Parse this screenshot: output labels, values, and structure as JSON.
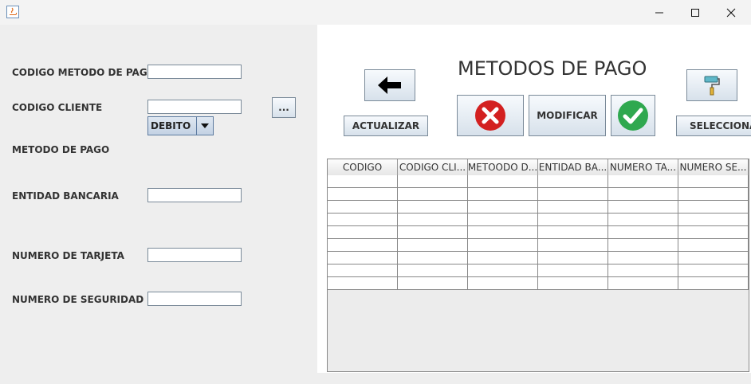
{
  "window": {
    "minimize_glyph": "—",
    "maximize_glyph": "☐",
    "close_glyph": "✕"
  },
  "form": {
    "codigo_metodo_label": "CODIGO METODO DE PAGO",
    "codigo_metodo_value": "",
    "codigo_cliente_label": "CODIGO CLIENTE",
    "codigo_cliente_value": "",
    "browse_button_label": "...",
    "metodo_label": "METODO DE PAGO",
    "metodo_selected": "DEBITO",
    "entidad_label": "ENTIDAD BANCARIA",
    "entidad_value": "",
    "tarjeta_label": "NUMERO DE TARJETA",
    "tarjeta_value": "",
    "seguridad_label": "NUMERO DE SEGURIDAD",
    "seguridad_value": ""
  },
  "header": {
    "title": "METODOS DE PAGO"
  },
  "toolbar": {
    "back_icon": "left-arrow-icon",
    "actualizar_label": "ACTUALIZAR",
    "delete_icon": "x-circle-icon",
    "modificar_label": "MODIFICAR",
    "confirm_icon": "check-circle-icon",
    "paint_icon": "paint-roller-icon",
    "seleccionar_label": "SELECCIONAR"
  },
  "colors": {
    "delete_red": "#d32020",
    "confirm_green": "#2fa84f"
  },
  "table": {
    "columns": [
      "CODIGO",
      "CODIGO CLI...",
      "METOODO D...",
      "ENTIDAD BA...",
      "NUMERO TA...",
      "NUMERO SE..."
    ],
    "rows": [
      [
        "",
        "",
        "",
        "",
        "",
        ""
      ],
      [
        "",
        "",
        "",
        "",
        "",
        ""
      ],
      [
        "",
        "",
        "",
        "",
        "",
        ""
      ],
      [
        "",
        "",
        "",
        "",
        "",
        ""
      ],
      [
        "",
        "",
        "",
        "",
        "",
        ""
      ],
      [
        "",
        "",
        "",
        "",
        "",
        ""
      ],
      [
        "",
        "",
        "",
        "",
        "",
        ""
      ],
      [
        "",
        "",
        "",
        "",
        "",
        ""
      ],
      [
        "",
        "",
        "",
        "",
        "",
        ""
      ]
    ]
  }
}
